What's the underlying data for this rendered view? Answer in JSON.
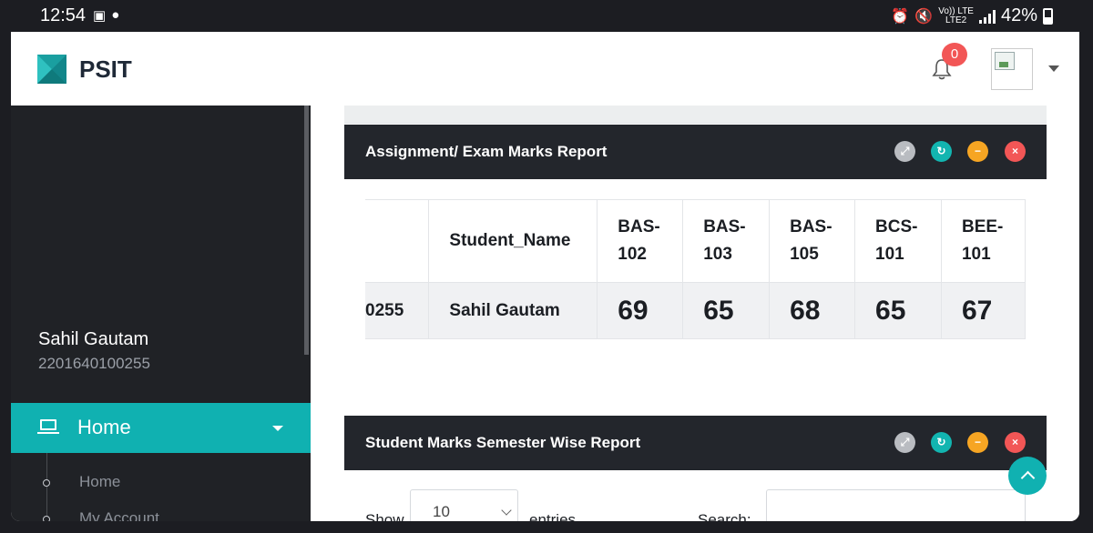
{
  "status_bar": {
    "time": "12:54",
    "battery": "42%",
    "network_top": "Vo)) LTE",
    "network_bottom": "LTE2"
  },
  "header": {
    "brand": "PSIT",
    "notification_count": "0"
  },
  "sidebar": {
    "user_name": "Sahil Gautam",
    "user_id": "2201640100255",
    "menu": {
      "home_label": "Home",
      "items": [
        {
          "label": "Home"
        },
        {
          "label": "My Account"
        }
      ]
    }
  },
  "marks_panel": {
    "title": "Assignment/ Exam Marks Report",
    "columns": [
      "",
      "Student_Name",
      "BAS-\n102",
      "BAS-\n103",
      "BAS-\n105",
      "BCS-\n101",
      "BEE-\n101"
    ],
    "rows": [
      {
        "id": "0255",
        "name": "Sahil Gautam",
        "marks": [
          "69",
          "65",
          "68",
          "65",
          "67"
        ]
      }
    ]
  },
  "semester_panel": {
    "title": "Student Marks Semester Wise Report",
    "show_label": "Show",
    "entries_value": "10",
    "entries_label": "entries",
    "search_label": "Search:"
  },
  "colors": {
    "accent": "#10b1b1",
    "sidebar_bg": "#202226",
    "panel_head_bg": "#23262c",
    "badge_red": "#f25656",
    "btn_gray": "#b9bcc1",
    "btn_teal": "#12b5b0",
    "btn_orange": "#f6a523",
    "btn_red": "#f25656"
  },
  "icons": {
    "expand": "expand-icon",
    "refresh": "refresh-icon",
    "collapse": "minus-icon",
    "close": "close-icon",
    "notifications": "bell-icon",
    "home": "laptop-icon",
    "scroll": "chevron-up-icon"
  }
}
